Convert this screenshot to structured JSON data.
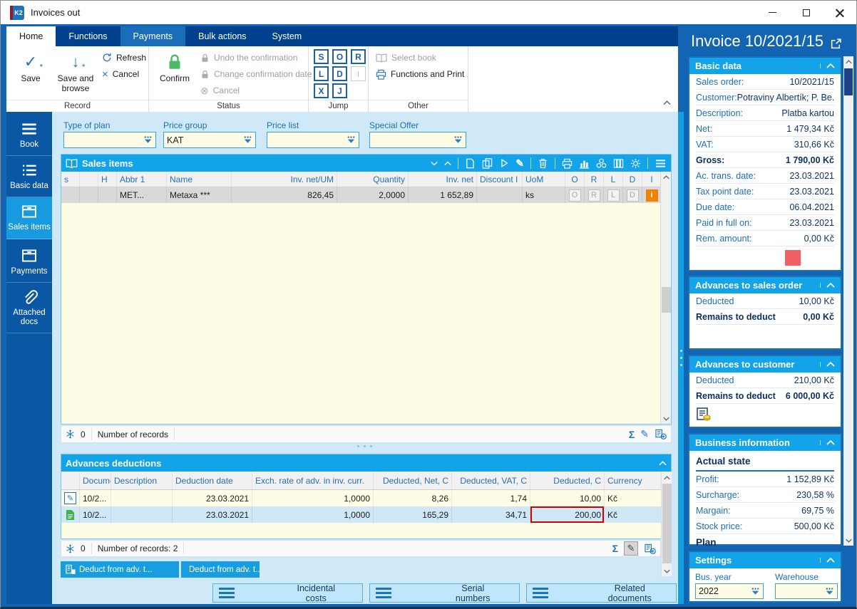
{
  "window": {
    "title": "Invoices out",
    "logo": "K2"
  },
  "ribbon": {
    "tabs": [
      "Home",
      "Functions",
      "Payments",
      "Bulk actions",
      "System"
    ],
    "record": {
      "label": "Record",
      "save": "Save",
      "save_browse": "Save and browse",
      "refresh": "Refresh",
      "cancel": "Cancel"
    },
    "status": {
      "label": "Status",
      "confirm": "Confirm",
      "undo": "Undo the confirmation",
      "change_date": "Change confirmation date",
      "cancel": "Cancel"
    },
    "jump": {
      "label": "Jump",
      "letters": [
        "S",
        "O",
        "R",
        "L",
        "D",
        "I",
        "X",
        "J"
      ]
    },
    "other": {
      "label": "Other",
      "select_book": "Select book",
      "functions_print": "Functions and Print"
    }
  },
  "sidebar": {
    "items": [
      {
        "label": "Book",
        "icon": "menu-icon"
      },
      {
        "label": "Basic data",
        "icon": "list-icon"
      },
      {
        "label": "Sales items",
        "icon": "box-icon",
        "active": true
      },
      {
        "label": "Payments",
        "icon": "box-icon"
      },
      {
        "label": "Attached docs",
        "icon": "paperclip-icon"
      }
    ]
  },
  "filters": [
    {
      "label": "Type of plan",
      "value": ""
    },
    {
      "label": "Price group",
      "value": "KAT"
    },
    {
      "label": "Price list",
      "value": ""
    },
    {
      "label": "Special Offer",
      "value": ""
    }
  ],
  "sales_items": {
    "title": "Sales items",
    "toolbar_icons": [
      "caret-down",
      "caret-up",
      "new-document",
      "copy",
      "run",
      "edit",
      "delete",
      "print",
      "chart",
      "functions",
      "columns",
      "settings",
      "menu"
    ],
    "columns": [
      "s",
      "",
      "H",
      "Abbr 1",
      "Name",
      "Inv. net/UM",
      "Quantity",
      "Inv. net",
      "Discount I",
      "UoM",
      "O",
      "R",
      "L",
      "D",
      "I"
    ],
    "rows": [
      {
        "abbr": "MET...",
        "name": "Metaxa ***",
        "inv_net_um": "826,45",
        "quantity": "2,0000",
        "inv_net": "1 652,89",
        "discount": "",
        "uom": "ks",
        "flags": [
          "O",
          "R",
          "L",
          "D"
        ],
        "i_flag": "i"
      }
    ],
    "status": {
      "count": "0",
      "label": "Number of records"
    }
  },
  "advances_deductions": {
    "title": "Advances deductions",
    "columns": [
      "",
      "Docume",
      "Description",
      "Deduction date",
      "Exch. rate of adv. in inv. curr.",
      "Deducted, Net, C",
      "Deducted, VAT, C",
      "Deducted, C",
      "Currency"
    ],
    "rows": [
      {
        "icon": "edit-row-icon",
        "document": "10/2...",
        "description": "",
        "date": "23.03.2021",
        "rate": "1,0000",
        "net": "8,26",
        "vat": "1,74",
        "deducted": "10,00",
        "currency": "Kč"
      },
      {
        "icon": "green-doc-icon",
        "document": "10/2...",
        "description": "",
        "date": "23.03.2021",
        "rate": "1,0000",
        "net": "165,29",
        "vat": "34,71",
        "deducted": "200,00",
        "currency": "Kč"
      }
    ],
    "status": {
      "count": "0",
      "label": "Number of records: 2"
    },
    "buttons": [
      "Deduct from adv. t...",
      "Deduct from adv. t..."
    ]
  },
  "bottom_bar": {
    "buttons": [
      "Incidental costs",
      "Serial numbers",
      "Related documents"
    ]
  },
  "right_panel": {
    "title": "Invoice 10/2021/15",
    "basic_data": {
      "title": "Basic data",
      "rows": [
        {
          "label": "Sales order:",
          "value": "10/2021/15"
        },
        {
          "label": "Customer:",
          "value": "Potraviny Albertík; P. Be..."
        },
        {
          "label": "Description:",
          "value": "Platba kartou"
        },
        {
          "label": "Net:",
          "value": "1 479,34 Kč"
        },
        {
          "label": "VAT:",
          "value": "310,66 Kč"
        },
        {
          "label": "Gross:",
          "value": "1 790,00 Kč"
        },
        {
          "label": "Ac. trans. date:",
          "value": "23.03.2021"
        },
        {
          "label": "Tax point date:",
          "value": "23.03.2021"
        },
        {
          "label": "Due date:",
          "value": "06.04.2021"
        },
        {
          "label": "Paid in full on:",
          "value": "23.03.2021"
        },
        {
          "label": "Rem. amount:",
          "value": "0,00 Kč"
        }
      ]
    },
    "advances_sales_order": {
      "title": "Advances to sales order",
      "rows": [
        {
          "label": "Deducted",
          "value": "10,00 Kč"
        },
        {
          "label": "Remains to deduct",
          "value": "0,00 Kč"
        }
      ]
    },
    "advances_customer": {
      "title": "Advances to customer",
      "rows": [
        {
          "label": "Deducted",
          "value": "210,00 Kč"
        },
        {
          "label": "Remains to deduct",
          "value": "6 000,00 Kč"
        }
      ]
    },
    "business_information": {
      "title": "Business information",
      "subtitle": "Actual state",
      "rows": [
        {
          "label": "Profit:",
          "value": "1 152,89 Kč"
        },
        {
          "label": "Surcharge:",
          "value": "230,58 %"
        },
        {
          "label": "Margain:",
          "value": "69,75 %"
        },
        {
          "label": "Stock price:",
          "value": "500,00 Kč"
        }
      ],
      "clipped_heading": "Plan"
    },
    "settings": {
      "title": "Settings",
      "fields": [
        {
          "label": "Bus. year",
          "value": "2022"
        },
        {
          "label": "Warehouse",
          "value": ""
        }
      ]
    }
  },
  "colors": {
    "window_blue": "#1365b4",
    "tabbar_navy": "#00418e",
    "panel_header_blue": "#13a3e8",
    "sidebar_blue": "#0a57a4",
    "sidebar_active": "#189ae0",
    "accent_button": "#189de0",
    "grid_yellow": "#fffce5",
    "flag_orange": "#ef8200",
    "status_red": "#f05f63",
    "selection_red_border": "#d40000",
    "confirm_green": "#4cba64",
    "card_border": "#1b6fb5"
  }
}
